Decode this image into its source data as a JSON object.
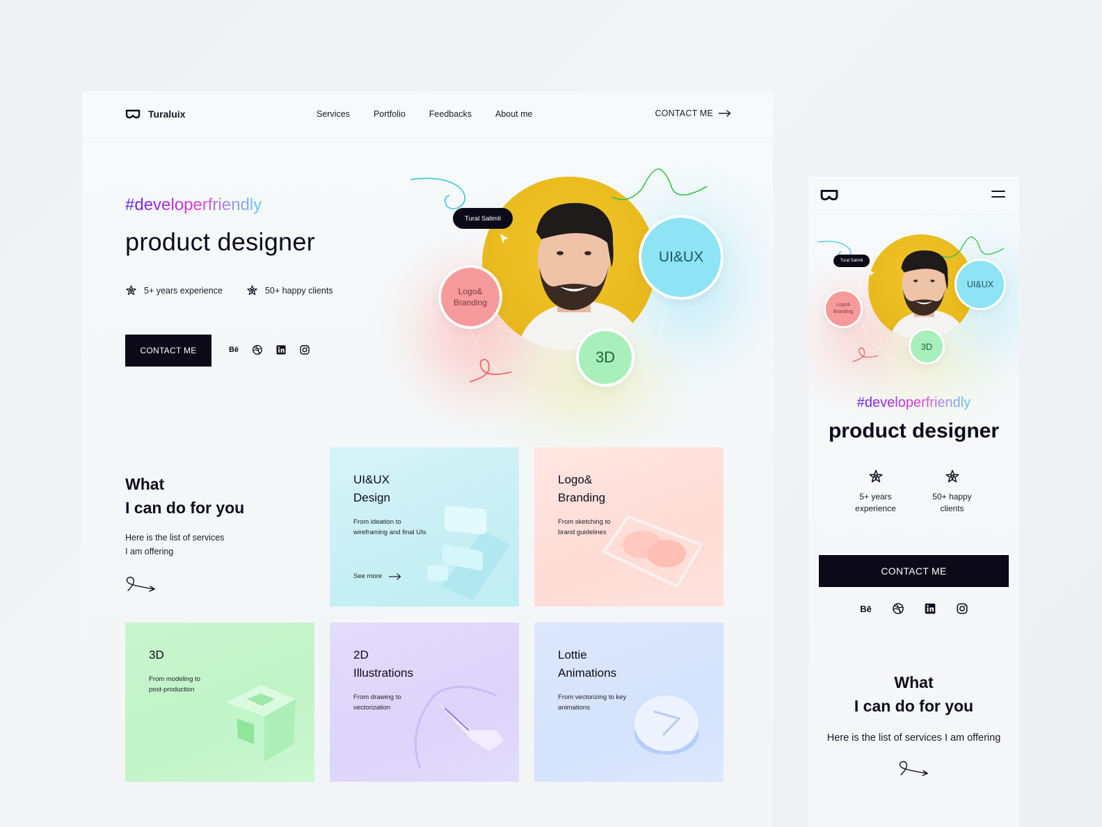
{
  "brand": {
    "name": "Turaluix",
    "logo_icon": "goggles-logo-icon"
  },
  "desktop": {
    "nav": {
      "items": [
        {
          "label": "Services"
        },
        {
          "label": "Portfolio"
        },
        {
          "label": "Feedbacks"
        },
        {
          "label": "About me"
        }
      ],
      "contact_label": "CONTACT ME",
      "contact_icon": "arrow-right-icon"
    },
    "hero": {
      "hashtag": "#developerfriendly",
      "title": "product designer",
      "stats": [
        {
          "icon": "star-icon",
          "label": "5+ years experience"
        },
        {
          "icon": "star-icon",
          "label": "50+ happy clients"
        }
      ],
      "cta_label": "CONTACT ME",
      "socials": [
        {
          "name": "behance",
          "glyph": "Bē"
        },
        {
          "name": "dribbble",
          "glyph": ""
        },
        {
          "name": "linkedin",
          "glyph": ""
        },
        {
          "name": "instagram",
          "glyph": ""
        }
      ],
      "art": {
        "name_tag": "Tural Salimli",
        "bubbles": [
          {
            "label": "UI&UX",
            "color": "#8ee3f5"
          },
          {
            "label": "Logo& Branding",
            "line1": "Logo&",
            "line2": "Branding",
            "color": "#f79a9b"
          },
          {
            "label": "3D",
            "color": "#a9efbb"
          }
        ],
        "photo_bg": "#ebbe1f"
      }
    },
    "services": {
      "heading_line1": "What",
      "heading_line2": "I can do for you",
      "sub_line1": "Here is the list of services",
      "sub_line2": "I am offering",
      "cards": [
        {
          "title_line1": "UI&UX",
          "title_line2": "Design",
          "desc_line1": "From ideation to",
          "desc_line2": "wireframing and final UIs",
          "more": "See more",
          "color": "#c9f0f5"
        },
        {
          "title_line1": "Logo&",
          "title_line2": "Branding",
          "desc_line1": "From sketching to",
          "desc_line2": "brand guidelines",
          "color": "#ffe0da"
        },
        {
          "title_line1": "3D",
          "title_line2": "",
          "desc_line1": "From modeling to",
          "desc_line2": "post-production",
          "color": "#c5f4ca"
        },
        {
          "title_line1": "2D",
          "title_line2": "Illustrations",
          "desc_line1": "From drawing to",
          "desc_line2": "vectorization",
          "color": "#ded7fb"
        },
        {
          "title_line1": "Lottie",
          "title_line2": "Animations",
          "desc_line1": "From vectorizing to key",
          "desc_line2": "animations",
          "color": "#d8e5fd"
        }
      ]
    }
  },
  "mobile": {
    "menu_icon": "hamburger-menu-icon",
    "hero": {
      "hashtag": "#developerfriendly",
      "title": "product designer",
      "stats": [
        {
          "line1": "5+ years",
          "line2": "experience"
        },
        {
          "line1": "50+ happy",
          "line2": "clients"
        }
      ],
      "cta_label": "CONTACT ME",
      "art": {
        "name_tag": "Tural Salimli",
        "bubble_ui": "UI&UX",
        "bubble_logo_line1": "Logo&",
        "bubble_logo_line2": "Branding",
        "bubble_3d": "3D"
      }
    },
    "services": {
      "heading_line1": "What",
      "heading_line2": "I can do for you",
      "sub": "Here is the list of services I am offering"
    }
  }
}
